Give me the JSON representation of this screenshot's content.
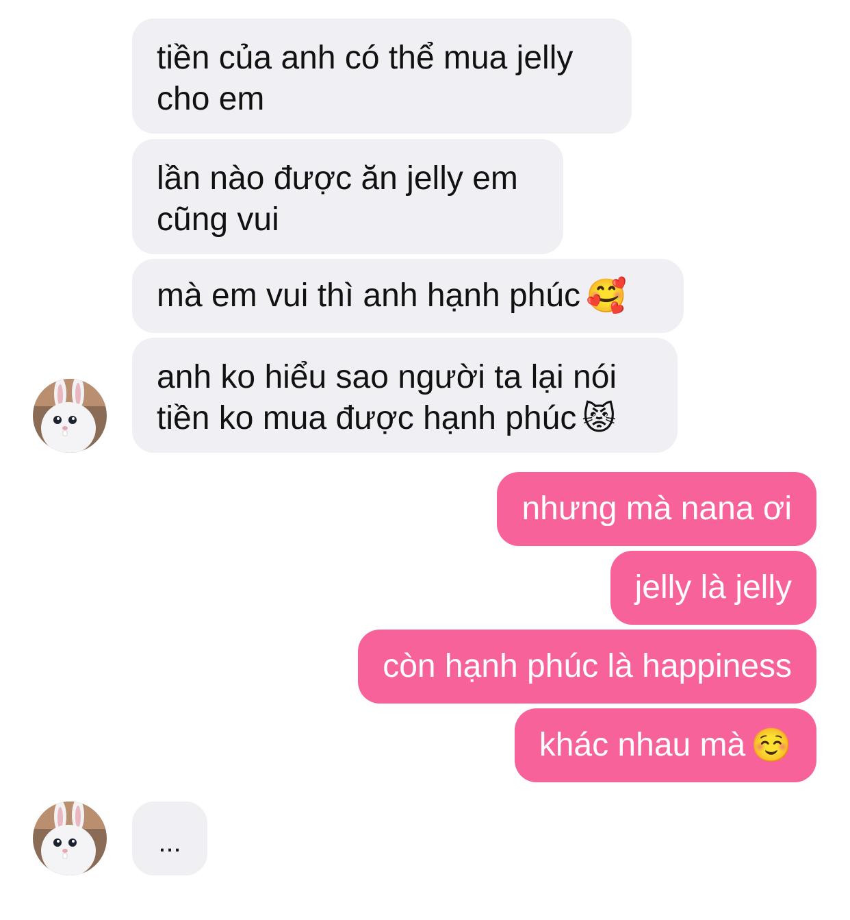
{
  "conversation": {
    "incoming": [
      {
        "lines": [
          "tiền của anh có thể mua jelly",
          "cho em"
        ],
        "emoji": ""
      },
      {
        "lines": [
          "lần nào được ăn jelly em",
          "cũng vui"
        ],
        "emoji": ""
      },
      {
        "lines": [
          "mà em vui thì anh hạnh phúc"
        ],
        "emoji": "🥰"
      },
      {
        "lines": [
          "anh ko hiểu sao người ta lại nói",
          "tiền ko mua được hạnh phúc"
        ],
        "emoji": "😾"
      }
    ],
    "outgoing": [
      {
        "text": "nhưng mà nana ơi",
        "emoji": ""
      },
      {
        "text": "jelly là jelly",
        "emoji": ""
      },
      {
        "text": "còn hạnh phúc là happiness",
        "emoji": ""
      },
      {
        "text": "khác nhau mà",
        "emoji": "☺️"
      }
    ],
    "typing": {
      "text": "..."
    }
  },
  "avatar": {
    "icon": "bunny-avatar-icon"
  },
  "colors": {
    "incoming_bubble": "#efeff4",
    "outgoing_bubble": "#f8629a",
    "incoming_text": "#111111",
    "outgoing_text": "#ffffff"
  }
}
